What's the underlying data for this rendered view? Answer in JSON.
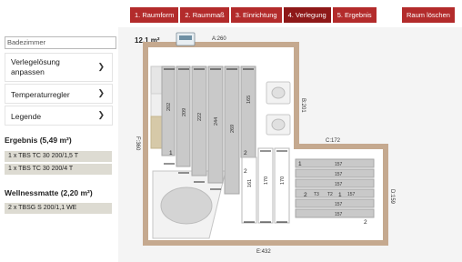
{
  "steps": [
    {
      "label": "1. Raumform",
      "active": false
    },
    {
      "label": "2. Raummaß",
      "active": false
    },
    {
      "label": "3. Einrichtung",
      "active": false
    },
    {
      "label": "4. Verlegung",
      "active": true
    },
    {
      "label": "5. Ergebnis",
      "active": false
    }
  ],
  "reset_label": "Raum löschen",
  "room_name": "Badezimmer",
  "panels": [
    {
      "label": "Verlegelösung anpassen"
    },
    {
      "label": "Temperaturregler"
    },
    {
      "label": "Legende"
    }
  ],
  "result": {
    "title": "Ergebnis (5,49 m²)",
    "items": [
      "1 x TBS TC 30 200/1,5 T",
      "1 x TBS TC 30 200/4 T"
    ]
  },
  "wellness": {
    "title": "Wellnessmatte (2,20 m²)",
    "items": [
      "2 x TBSG S 200/1,1 WE"
    ]
  },
  "plan": {
    "area": "12,1 m²",
    "dims": {
      "a": "A:260",
      "b": "B:201",
      "c": "C:172",
      "d": "D:159",
      "e": "E:432",
      "f": "F:360"
    },
    "vertical_strips": [
      "202",
      "209",
      "222",
      "244",
      "269",
      "165"
    ],
    "center_strips": [
      "161",
      "170",
      "170"
    ],
    "horizontal_strips": [
      "157",
      "157",
      "157",
      "157",
      "157",
      "157"
    ],
    "numbers": [
      "1",
      "2",
      "2",
      "1",
      "2",
      "1",
      "2"
    ],
    "t_labels": [
      "T3",
      "T2"
    ]
  },
  "colors": {
    "accent": "#b32b2b",
    "accent_active": "#8e1818",
    "wall": "#c5a98f",
    "strip": "#c9c9c9"
  },
  "icons": {
    "thermostat": "thermostat-icon",
    "chevron": "chevron-down-icon"
  }
}
